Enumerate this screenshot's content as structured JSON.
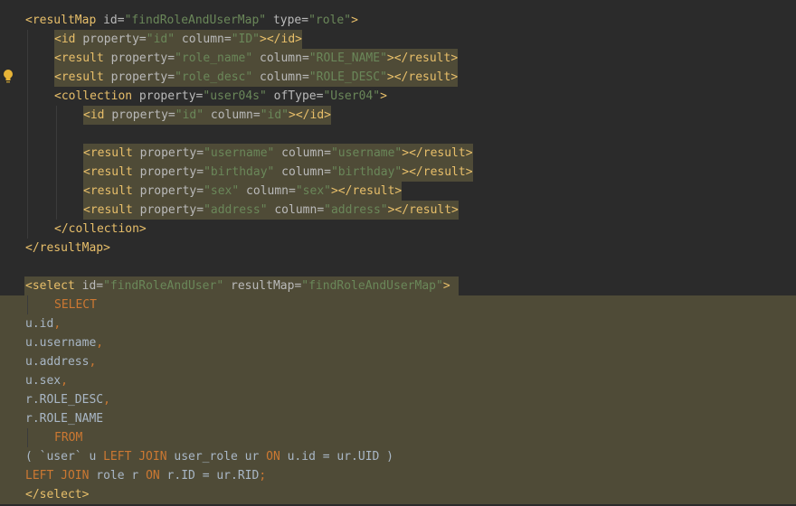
{
  "editor": {
    "lines": [
      {
        "indent": 0,
        "sel": false,
        "hl": false,
        "tokens": [
          [
            "tag",
            "<resultMap "
          ],
          [
            "attr",
            "id="
          ],
          [
            "val",
            "\"findRoleAndUserMap\""
          ],
          [
            "attr",
            " type="
          ],
          [
            "val",
            "\"role\""
          ],
          [
            "tag",
            ">"
          ]
        ]
      },
      {
        "indent": 1,
        "sel": false,
        "hl": true,
        "tokens": [
          [
            "tag",
            "<id "
          ],
          [
            "attr",
            "property="
          ],
          [
            "val",
            "\"id\""
          ],
          [
            "attr",
            " column="
          ],
          [
            "val",
            "\"ID\""
          ],
          [
            "tag",
            "></id>"
          ]
        ]
      },
      {
        "indent": 1,
        "sel": false,
        "hl": true,
        "tokens": [
          [
            "tag",
            "<result "
          ],
          [
            "attr",
            "property="
          ],
          [
            "val",
            "\"role_name\""
          ],
          [
            "attr",
            " column="
          ],
          [
            "val",
            "\"ROLE_NAME\""
          ],
          [
            "tag",
            "></result>"
          ]
        ]
      },
      {
        "indent": 1,
        "sel": false,
        "hl": true,
        "tokens": [
          [
            "tag",
            "<result "
          ],
          [
            "attr",
            "property="
          ],
          [
            "val",
            "\"role_desc\""
          ],
          [
            "attr",
            " column="
          ],
          [
            "val",
            "\"ROLE_DESC\""
          ],
          [
            "tag",
            "></result>"
          ]
        ]
      },
      {
        "indent": 1,
        "sel": false,
        "hl": false,
        "tokens": [
          [
            "tag",
            "<collection "
          ],
          [
            "attr",
            "property="
          ],
          [
            "val",
            "\"user04s\""
          ],
          [
            "attr",
            " ofType="
          ],
          [
            "val",
            "\"User04\""
          ],
          [
            "tag",
            ">"
          ]
        ]
      },
      {
        "indent": 2,
        "sel": false,
        "hl": true,
        "tokens": [
          [
            "tag",
            "<id "
          ],
          [
            "attr",
            "property="
          ],
          [
            "val",
            "\"id\""
          ],
          [
            "attr",
            " column="
          ],
          [
            "val",
            "\"id\""
          ],
          [
            "tag",
            "></id>"
          ]
        ]
      },
      {
        "indent": 2,
        "sel": false,
        "hl": false,
        "tokens": []
      },
      {
        "indent": 2,
        "sel": false,
        "hl": true,
        "tokens": [
          [
            "tag",
            "<result "
          ],
          [
            "attr",
            "property="
          ],
          [
            "val",
            "\"username\""
          ],
          [
            "attr",
            " column="
          ],
          [
            "val",
            "\"username\""
          ],
          [
            "tag",
            "></result>"
          ]
        ]
      },
      {
        "indent": 2,
        "sel": false,
        "hl": true,
        "tokens": [
          [
            "tag",
            "<result "
          ],
          [
            "attr",
            "property="
          ],
          [
            "val",
            "\"birthday\""
          ],
          [
            "attr",
            " column="
          ],
          [
            "val",
            "\"birthday\""
          ],
          [
            "tag",
            "></result>"
          ]
        ]
      },
      {
        "indent": 2,
        "sel": false,
        "hl": true,
        "tokens": [
          [
            "tag",
            "<result "
          ],
          [
            "attr",
            "property="
          ],
          [
            "val",
            "\"sex\""
          ],
          [
            "attr",
            " column="
          ],
          [
            "val",
            "\"sex\""
          ],
          [
            "tag",
            "></result>"
          ]
        ]
      },
      {
        "indent": 2,
        "sel": false,
        "hl": true,
        "tokens": [
          [
            "tag",
            "<result "
          ],
          [
            "attr",
            "property="
          ],
          [
            "val",
            "\"address\""
          ],
          [
            "attr",
            " column="
          ],
          [
            "val",
            "\"address\""
          ],
          [
            "tag",
            "></result>"
          ]
        ]
      },
      {
        "indent": 1,
        "sel": false,
        "hl": false,
        "tokens": [
          [
            "tag",
            "</collection>"
          ]
        ]
      },
      {
        "indent": 0,
        "sel": false,
        "hl": false,
        "tokens": [
          [
            "tag",
            "</resultMap>"
          ]
        ]
      },
      {
        "indent": 0,
        "sel": false,
        "hl": false,
        "tokens": []
      },
      {
        "indent": 0,
        "sel": false,
        "hl": "partial",
        "tokens": [
          [
            "tag",
            "<select "
          ],
          [
            "attr",
            "id="
          ],
          [
            "val",
            "\"findRoleAndUser\""
          ],
          [
            "attr",
            " resultMap="
          ],
          [
            "val",
            "\"findRoleAndUserMap\""
          ],
          [
            "tag",
            ">"
          ]
        ]
      },
      {
        "indent": 1,
        "sel": true,
        "hl": false,
        "tokens": [
          [
            "kw",
            "SELECT"
          ]
        ]
      },
      {
        "indent": 0,
        "sel": true,
        "hl": false,
        "tokens": [
          [
            "plain",
            "u.id"
          ],
          [
            "kw",
            ","
          ]
        ]
      },
      {
        "indent": 0,
        "sel": true,
        "hl": false,
        "tokens": [
          [
            "plain",
            "u.username"
          ],
          [
            "kw",
            ","
          ]
        ]
      },
      {
        "indent": 0,
        "sel": true,
        "hl": false,
        "tokens": [
          [
            "plain",
            "u.address"
          ],
          [
            "kw",
            ","
          ]
        ]
      },
      {
        "indent": 0,
        "sel": true,
        "hl": false,
        "tokens": [
          [
            "plain",
            "u.sex"
          ],
          [
            "kw",
            ","
          ]
        ]
      },
      {
        "indent": 0,
        "sel": true,
        "hl": false,
        "tokens": [
          [
            "plain",
            "r.ROLE_DESC"
          ],
          [
            "kw",
            ","
          ]
        ]
      },
      {
        "indent": 0,
        "sel": true,
        "hl": false,
        "tokens": [
          [
            "plain",
            "r.ROLE_NAME"
          ]
        ]
      },
      {
        "indent": 1,
        "sel": true,
        "hl": false,
        "tokens": [
          [
            "kw",
            "FROM"
          ]
        ]
      },
      {
        "indent": 0,
        "sel": true,
        "hl": false,
        "tokens": [
          [
            "plain",
            "( `user` u "
          ],
          [
            "kw",
            "LEFT JOIN"
          ],
          [
            "plain",
            " user_role ur "
          ],
          [
            "kw",
            "ON"
          ],
          [
            "plain",
            " u.id = ur.UID )"
          ]
        ]
      },
      {
        "indent": 0,
        "sel": true,
        "hl": false,
        "tokens": [
          [
            "kw",
            "LEFT JOIN"
          ],
          [
            "plain",
            " role r "
          ],
          [
            "kw",
            "ON"
          ],
          [
            "plain",
            " r.ID = ur.RID"
          ],
          [
            "kw",
            ";"
          ]
        ]
      },
      {
        "indent": 0,
        "sel": true,
        "hl": false,
        "tokens": [
          [
            "tag",
            "</select>"
          ]
        ]
      }
    ],
    "gutter_icon": "lightbulb-icon",
    "colors": {
      "background": "#2b2b2b",
      "selection": "#4f4b37",
      "tag": "#e8bf6a",
      "attr": "#bababa",
      "value": "#6a8759",
      "keyword": "#cc7832",
      "text": "#a9b7c6"
    }
  }
}
